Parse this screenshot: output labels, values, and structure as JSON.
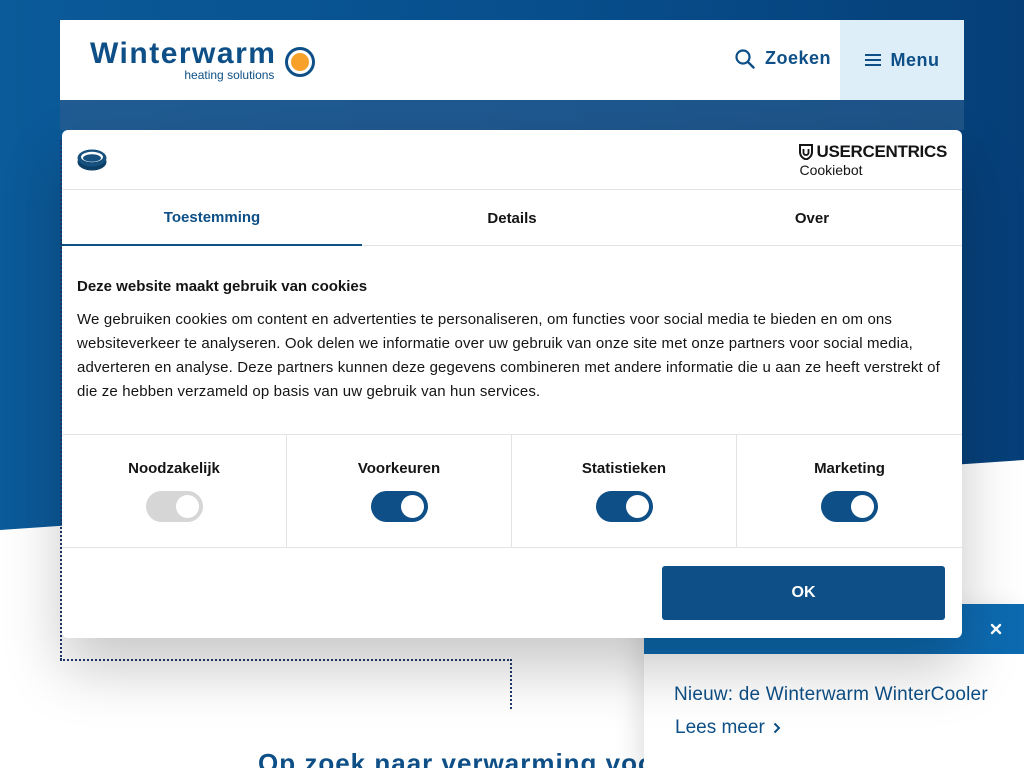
{
  "header": {
    "logo_brand": "Winterwarm",
    "logo_tagline": "heating solutions",
    "search_label": "Zoeken",
    "menu_label": "Menu"
  },
  "background": {
    "heading": "Op zoek naar verwarming voor u"
  },
  "cookie_dialog": {
    "brand_top": "USERCENTRICS",
    "brand_bottom": "Cookiebot",
    "tabs": [
      {
        "label": "Toestemming",
        "active": true
      },
      {
        "label": "Details",
        "active": false
      },
      {
        "label": "Over",
        "active": false
      }
    ],
    "title": "Deze website maakt gebruik van cookies",
    "text": "We gebruiken cookies om content en advertenties te personaliseren, om functies voor social media te bieden en om ons websiteverkeer te analyseren. Ook delen we informatie over uw gebruik van onze site met onze partners voor social media, adverteren en analyse. Deze partners kunnen deze gegevens combineren met andere informatie die u aan ze heeft verstrekt of die ze hebben verzameld op basis van uw gebruik van hun services.",
    "toggles": [
      {
        "label": "Noodzakelijk",
        "on": true,
        "disabled": true
      },
      {
        "label": "Voorkeuren",
        "on": true,
        "disabled": false
      },
      {
        "label": "Statistieken",
        "on": true,
        "disabled": false
      },
      {
        "label": "Marketing",
        "on": true,
        "disabled": false
      }
    ],
    "ok_label": "OK"
  },
  "news": {
    "title": "Nieuw: de Winterwarm WinterCooler",
    "link_label": "Lees meer"
  },
  "colors": {
    "brand_blue": "#0d4f86",
    "news_bar": "#0d6ab0",
    "menu_bg": "#ddeef8",
    "logo_orange": "#f7a12a"
  },
  "icons": {
    "search": "search-icon",
    "menu": "hamburger-icon",
    "cookie": "cookie-icon",
    "close": "close-icon",
    "chevron": "chevron-right-icon"
  }
}
